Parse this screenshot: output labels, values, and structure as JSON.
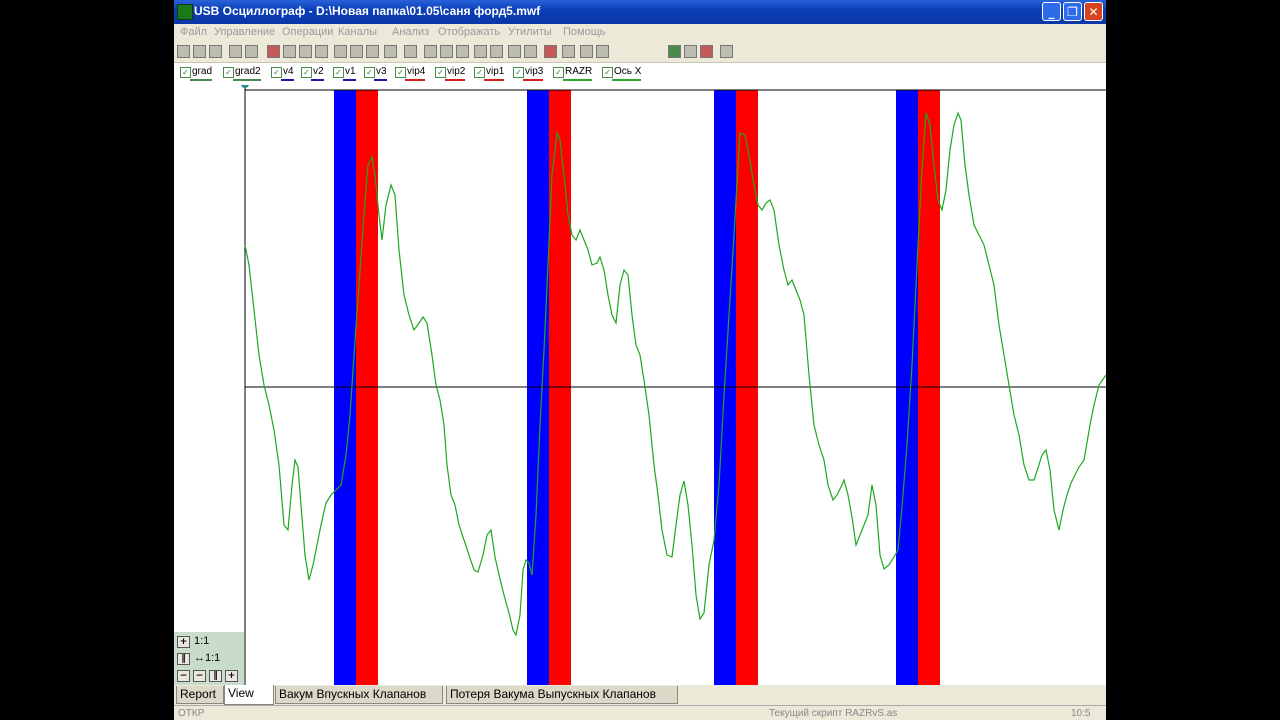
{
  "window": {
    "title": "USB Осциллограф - D:\\Новая папка\\01.05\\саня форд5.mwf",
    "minimize_icon": "minimize-icon",
    "maximize_icon": "maximize-icon",
    "close_icon": "close-icon"
  },
  "menu": {
    "items": [
      "Файл",
      "Управление",
      "Операции",
      "Каналы",
      "Анализ",
      "Отображать",
      "Утилиты",
      "Помощь"
    ]
  },
  "legend": {
    "channels": [
      {
        "label": "grad",
        "checked": true,
        "color": "#4a8a4a"
      },
      {
        "label": "grad2",
        "checked": true,
        "color": "#4a8a4a"
      },
      {
        "label": "v4",
        "checked": true,
        "color": "#1a1aa8"
      },
      {
        "label": "v2",
        "checked": true,
        "color": "#1a1aa8"
      },
      {
        "label": "v1",
        "checked": true,
        "color": "#1a1aa8"
      },
      {
        "label": "v3",
        "checked": true,
        "color": "#1a1aa8"
      },
      {
        "label": "vip4",
        "checked": true,
        "color": "#d82020"
      },
      {
        "label": "vip2",
        "checked": true,
        "color": "#d82020"
      },
      {
        "label": "vip1",
        "checked": true,
        "color": "#d82020"
      },
      {
        "label": "vip3",
        "checked": true,
        "color": "#d82020"
      },
      {
        "label": "RAZR",
        "checked": true,
        "color": "#2fa82f"
      },
      {
        "label": "Ось X",
        "checked": true,
        "color": "#2fa82f"
      }
    ]
  },
  "zoom": {
    "vertical": "1:1",
    "horizontal": "↔1:1"
  },
  "tabs": [
    "Report",
    "View",
    "Вакум Впускных Клапанов",
    "Потеря Вакума Выпускных Клапанов"
  ],
  "active_tab": "View",
  "status": {
    "left": "ОТКР",
    "middle": "Текущий скрипт RAZRvS.as",
    "right": "10:5"
  },
  "chart_data": {
    "type": "line",
    "series_color": "#1fa81f",
    "blue_band_color": "#0000ff",
    "red_band_color": "#ff0000",
    "periods": 4
  }
}
